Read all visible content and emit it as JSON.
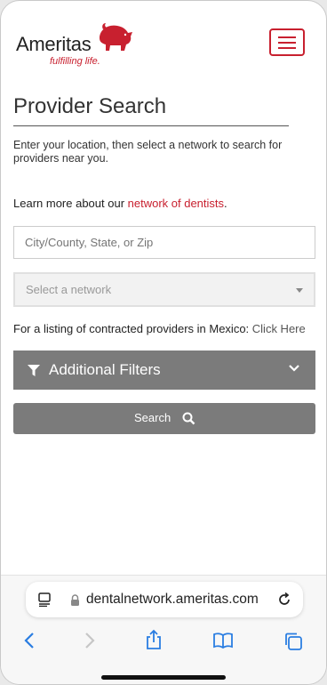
{
  "brand": {
    "name": "Ameritas",
    "tagline": "fulfilling life.",
    "accent": "#c8202f"
  },
  "page": {
    "title": "Provider Search",
    "intro": "Enter your location, then select a network to search for providers near you.",
    "learn_prefix": "Learn more about our ",
    "learn_link": "network of dentists",
    "learn_suffix": ".",
    "location_placeholder": "City/County, State, or Zip",
    "network_selected": "Select a network",
    "mexico_text": "For a listing of contracted providers in Mexico: ",
    "mexico_link": "Click Here",
    "filters_label": "Additional Filters",
    "search_label": "Search"
  },
  "browser": {
    "url": "dentalnetwork.ameritas.com"
  },
  "icons": [
    "hamburger-icon",
    "filter-icon",
    "chevron-down-icon",
    "search-icon",
    "reader-icon",
    "lock-icon",
    "reload-icon",
    "back-icon",
    "forward-icon",
    "share-icon",
    "bookmarks-icon",
    "tabs-icon"
  ]
}
